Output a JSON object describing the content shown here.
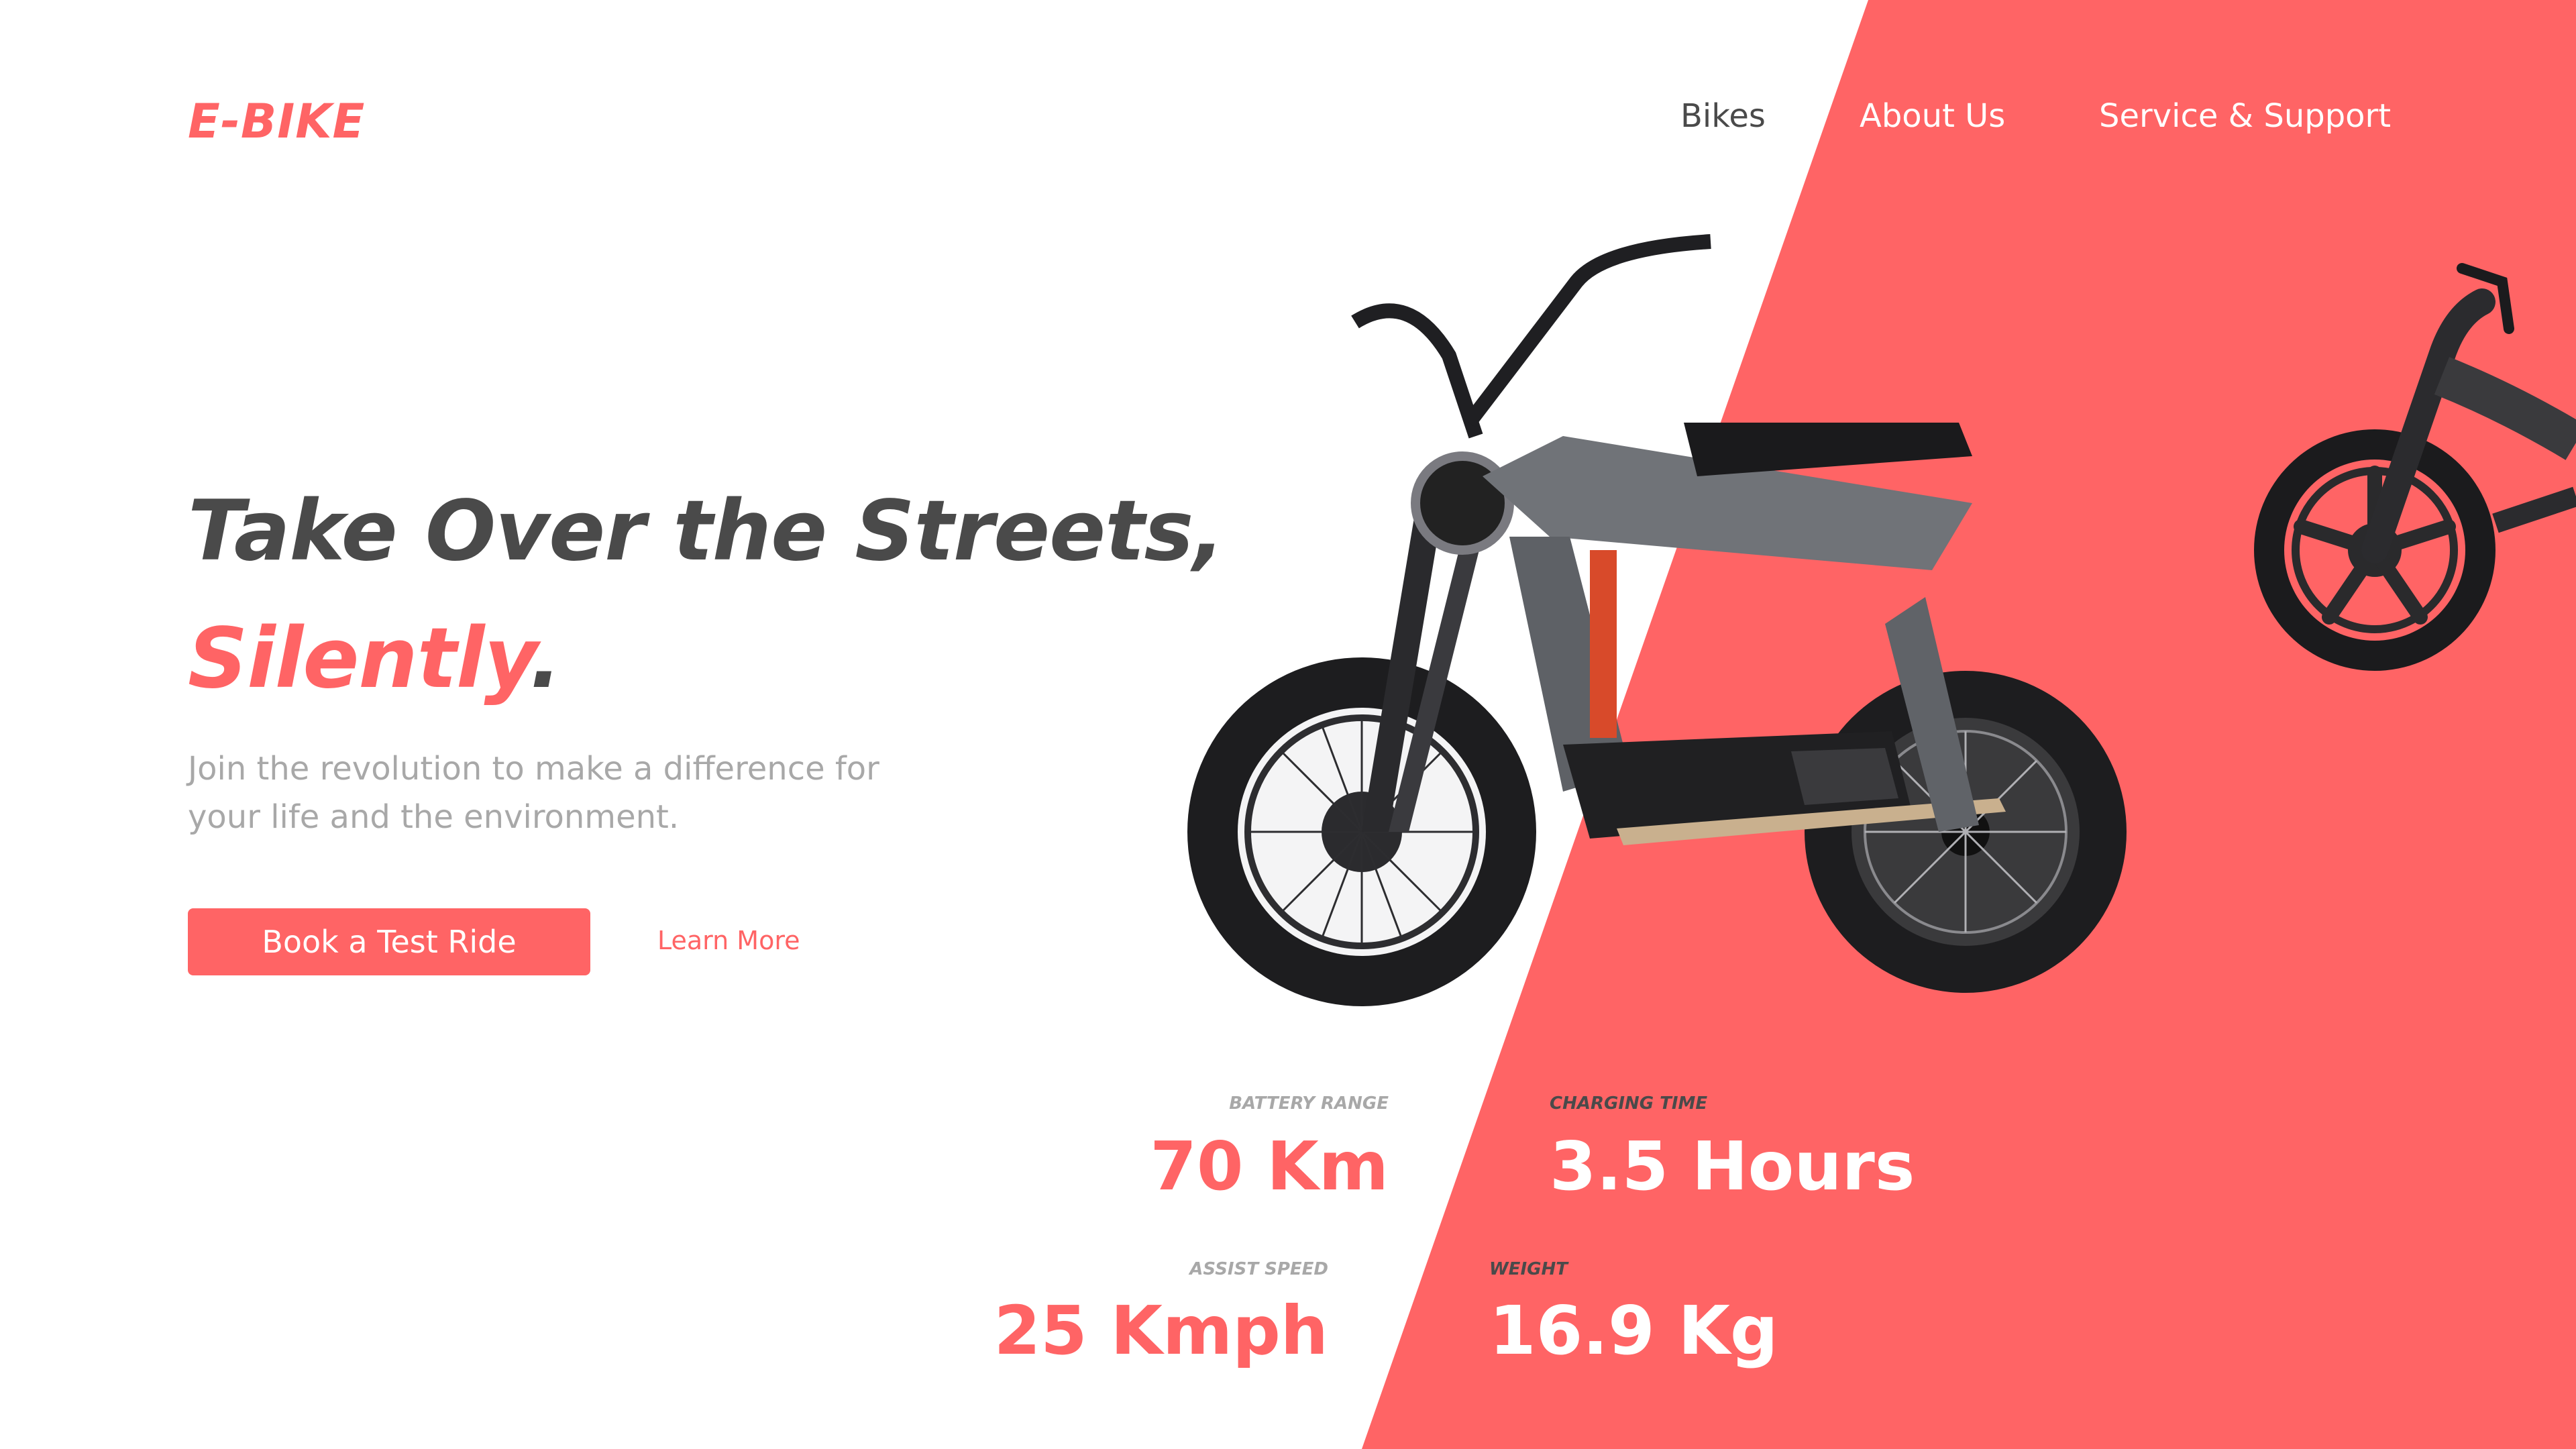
{
  "brand": {
    "logo": "E-BIKE"
  },
  "nav": {
    "items": [
      "Bikes",
      "About Us",
      "Service & Support"
    ]
  },
  "hero": {
    "headline_line1": "Take Over the Streets,",
    "headline_line2_highlight": "Silently",
    "headline_line2_end": ".",
    "subtext_line1": "Join the revolution to make a difference for",
    "subtext_line2": "your life and the environment.",
    "cta_primary": "Book a Test Ride",
    "cta_secondary": "Learn More"
  },
  "specs": [
    {
      "label": "BATTERY RANGE",
      "value": "70 Km"
    },
    {
      "label": "CHARGING TIME",
      "value": "3.5 Hours"
    },
    {
      "label": "ASSIST SPEED",
      "value": "25 Kmph"
    },
    {
      "label": "WEIGHT",
      "value": "16.9 Kg"
    }
  ],
  "colors": {
    "accent": "#ff6465",
    "text_dark": "#4a4a4a",
    "text_muted": "#a8a8a8",
    "background": "#ffffff"
  },
  "images": {
    "main_bike": "electric-moto-bike-icon",
    "side_bike": "electric-bicycle-icon"
  }
}
